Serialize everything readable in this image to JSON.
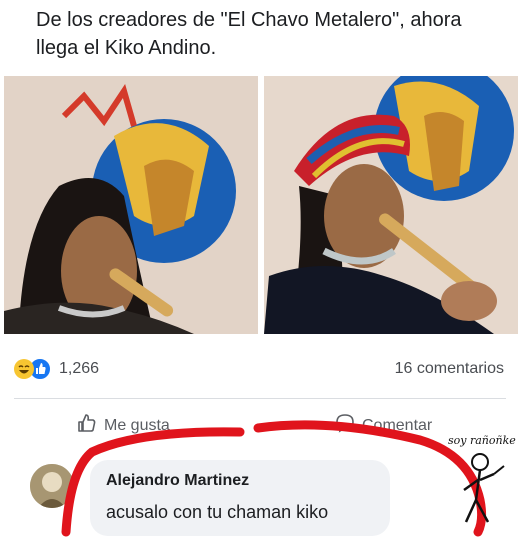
{
  "post": {
    "caption": "De los creadores de \"El Chavo Metalero\", ahora llega el Kiko Andino."
  },
  "stats": {
    "reaction_count": "1,266",
    "comments_label": "16 comentarios",
    "reactions": [
      "haha-icon",
      "like-icon"
    ]
  },
  "actions": {
    "like_label": "Me gusta",
    "comment_label": "Comentar"
  },
  "comment": {
    "author": "Alejandro Martinez",
    "text": "acusalo con tu chaman kiko"
  },
  "watermark": {
    "text": "soy rañoñker"
  },
  "colors": {
    "like_blue": "#1877f2",
    "haha_yellow": "#f7c531",
    "annotation_red": "#e0141c",
    "comment_bubble": "#f0f2f5"
  }
}
